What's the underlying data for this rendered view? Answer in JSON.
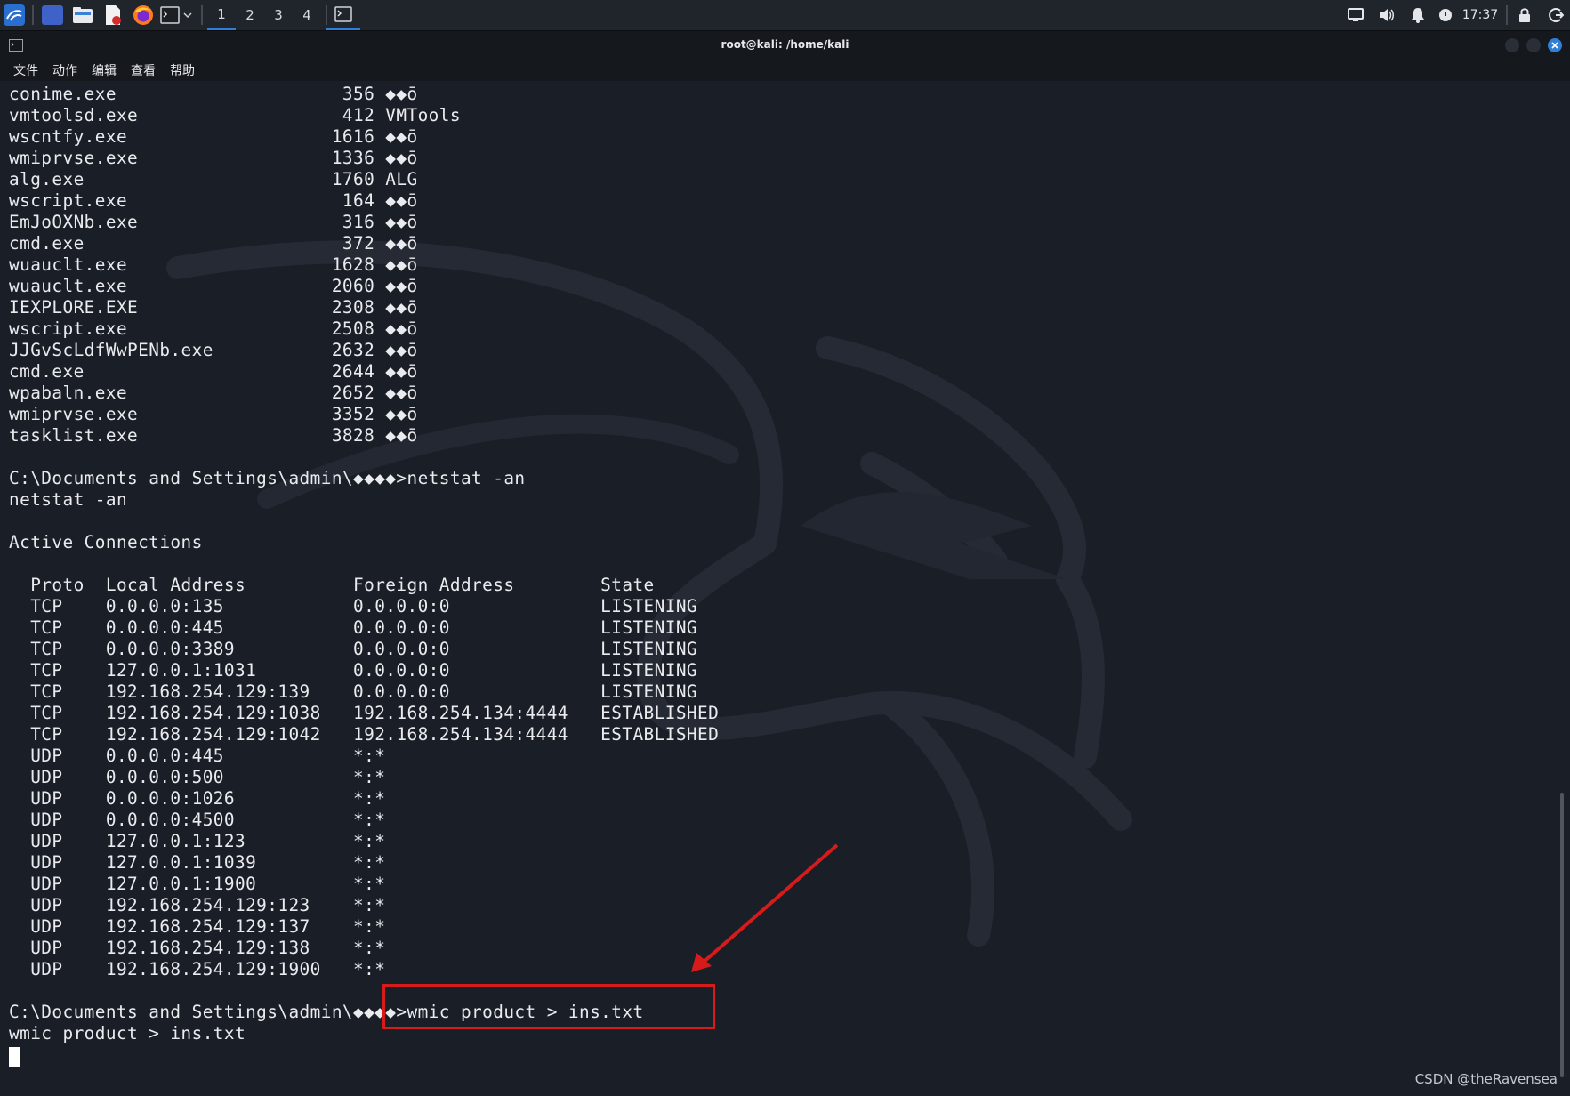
{
  "panel": {
    "workspaces": [
      "1",
      "2",
      "3",
      "4"
    ],
    "active_workspace": "1",
    "clock": "17:37",
    "icons": [
      "kali-menu-icon",
      "desktop-icon",
      "file-manager-icon",
      "text-editor-icon",
      "firefox-icon",
      "terminal-icon",
      "dropdown-chevron-icon",
      "active-window-icon",
      "display-icon",
      "volume-icon",
      "notification-bell-icon",
      "power-icon",
      "lock-icon",
      "logout-icon"
    ]
  },
  "window": {
    "title": "root@kali: /home/kali",
    "menu": [
      "文件",
      "动作",
      "编辑",
      "查看",
      "帮助"
    ]
  },
  "terminal": {
    "process_rows": [
      {
        "image": "conime.exe",
        "pid": "356",
        "session": "◆◆ō"
      },
      {
        "image": "vmtoolsd.exe",
        "pid": "412",
        "session": "VMTools"
      },
      {
        "image": "wscntfy.exe",
        "pid": "1616",
        "session": "◆◆ō"
      },
      {
        "image": "wmiprvse.exe",
        "pid": "1336",
        "session": "◆◆ō"
      },
      {
        "image": "alg.exe",
        "pid": "1760",
        "session": "ALG"
      },
      {
        "image": "wscript.exe",
        "pid": "164",
        "session": "◆◆ō"
      },
      {
        "image": "EmJoOXNb.exe",
        "pid": "316",
        "session": "◆◆ō"
      },
      {
        "image": "cmd.exe",
        "pid": "372",
        "session": "◆◆ō"
      },
      {
        "image": "wuauclt.exe",
        "pid": "1628",
        "session": "◆◆ō"
      },
      {
        "image": "wuauclt.exe",
        "pid": "2060",
        "session": "◆◆ō"
      },
      {
        "image": "IEXPLORE.EXE",
        "pid": "2308",
        "session": "◆◆ō"
      },
      {
        "image": "wscript.exe",
        "pid": "2508",
        "session": "◆◆ō"
      },
      {
        "image": "JJGvScLdfWwPENb.exe",
        "pid": "2632",
        "session": "◆◆ō"
      },
      {
        "image": "cmd.exe",
        "pid": "2644",
        "session": "◆◆ō"
      },
      {
        "image": "wpabaln.exe",
        "pid": "2652",
        "session": "◆◆ō"
      },
      {
        "image": "wmiprvse.exe",
        "pid": "3352",
        "session": "◆◆ō"
      },
      {
        "image": "tasklist.exe",
        "pid": "3828",
        "session": "◆◆ō"
      }
    ],
    "prompt": "C:\\Documents and Settings\\admin\\◆◆◆◆>",
    "netstat_command": "netstat -an",
    "netstat_echo": "netstat -an",
    "active_connections_label": "Active Connections",
    "netstat_headers": [
      "Proto",
      "Local Address",
      "Foreign Address",
      "State"
    ],
    "connections": [
      [
        "TCP",
        "0.0.0.0:135",
        "0.0.0.0:0",
        "LISTENING"
      ],
      [
        "TCP",
        "0.0.0.0:445",
        "0.0.0.0:0",
        "LISTENING"
      ],
      [
        "TCP",
        "0.0.0.0:3389",
        "0.0.0.0:0",
        "LISTENING"
      ],
      [
        "TCP",
        "127.0.0.1:1031",
        "0.0.0.0:0",
        "LISTENING"
      ],
      [
        "TCP",
        "192.168.254.129:139",
        "0.0.0.0:0",
        "LISTENING"
      ],
      [
        "TCP",
        "192.168.254.129:1038",
        "192.168.254.134:4444",
        "ESTABLISHED"
      ],
      [
        "TCP",
        "192.168.254.129:1042",
        "192.168.254.134:4444",
        "ESTABLISHED"
      ],
      [
        "UDP",
        "0.0.0.0:445",
        "*:*",
        ""
      ],
      [
        "UDP",
        "0.0.0.0:500",
        "*:*",
        ""
      ],
      [
        "UDP",
        "0.0.0.0:1026",
        "*:*",
        ""
      ],
      [
        "UDP",
        "0.0.0.0:4500",
        "*:*",
        ""
      ],
      [
        "UDP",
        "127.0.0.1:123",
        "*:*",
        ""
      ],
      [
        "UDP",
        "127.0.0.1:1039",
        "*:*",
        ""
      ],
      [
        "UDP",
        "127.0.0.1:1900",
        "*:*",
        ""
      ],
      [
        "UDP",
        "192.168.254.129:123",
        "*:*",
        ""
      ],
      [
        "UDP",
        "192.168.254.129:137",
        "*:*",
        ""
      ],
      [
        "UDP",
        "192.168.254.129:138",
        "*:*",
        ""
      ],
      [
        "UDP",
        "192.168.254.129:1900",
        "*:*",
        ""
      ]
    ],
    "wmic_command": "wmic product > ins.txt",
    "wmic_echo": "wmic product > ins.txt"
  },
  "annotation_color": "#d71a1a",
  "watermark": "CSDN @theRavensea"
}
